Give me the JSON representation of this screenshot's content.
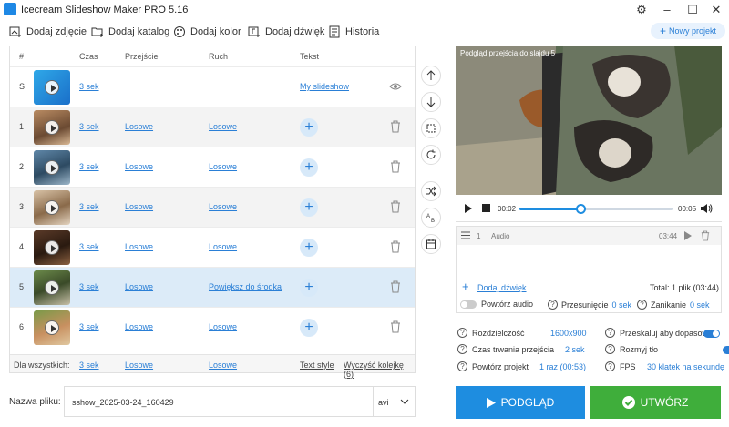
{
  "window": {
    "title": "Icecream Slideshow Maker PRO 5.16"
  },
  "toolbar": {
    "add_photo": "Dodaj zdjęcie",
    "add_folder": "Dodaj katalog",
    "add_color": "Dodaj kolor",
    "add_sound": "Dodaj dźwięk",
    "history": "Historia",
    "new_project": "Nowy projekt"
  },
  "table": {
    "headers": {
      "num": "#",
      "time": "Czas",
      "transition": "Przejście",
      "motion": "Ruch",
      "text": "Tekst"
    },
    "title_row": {
      "num": "S",
      "time": "3 sek",
      "text": "My slideshow"
    },
    "rows": [
      {
        "num": "1",
        "time": "3 sek",
        "transition": "Losowe",
        "motion": "Losowe"
      },
      {
        "num": "2",
        "time": "3 sek",
        "transition": "Losowe",
        "motion": "Losowe"
      },
      {
        "num": "3",
        "time": "3 sek",
        "transition": "Losowe",
        "motion": "Losowe"
      },
      {
        "num": "4",
        "time": "3 sek",
        "transition": "Losowe",
        "motion": "Losowe"
      },
      {
        "num": "5",
        "time": "3 sek",
        "transition": "Losowe",
        "motion": "Powiększ do środka"
      },
      {
        "num": "6",
        "time": "3 sek",
        "transition": "Losowe",
        "motion": "Losowe"
      }
    ],
    "footer": {
      "label": "Dla wszystkich:",
      "time": "3 sek",
      "transition": "Losowe",
      "motion": "Losowe",
      "text_style": "Text style",
      "clear": "Wyczyść kolejkę (6)"
    }
  },
  "preview": {
    "label": "Podgląd przejścia do slajdu 5",
    "current_time": "00:02",
    "total_time": "00:05",
    "progress": 0.4
  },
  "audio": {
    "track_num": "1",
    "track_label": "Audio",
    "track_time": "03:44",
    "add_sound": "Dodaj dźwięk",
    "total": "Total: 1 plik (03:44)",
    "repeat": "Powtórz audio",
    "offset_label": "Przesunięcie",
    "offset_value": "0 sek",
    "fade_label": "Zanikanie",
    "fade_value": "0 sek"
  },
  "settings": {
    "resolution_label": "Rozdzielczość",
    "resolution_value": "1600x900",
    "scale_label": "Przeskaluj aby dopasow.",
    "duration_label": "Czas trwania przejścia",
    "duration_value": "2 sek",
    "blur_label": "Rozmyj tło",
    "repeat_label": "Powtórz projekt",
    "repeat_value": "1 raz (00:53)",
    "fps_label": "FPS",
    "fps_value": "30 klatek na sekundę"
  },
  "file": {
    "label": "Nazwa pliku:",
    "name": "sshow_2025-03-24_160429",
    "format": "avi"
  },
  "actions": {
    "preview": "PODGLĄD",
    "create": "UTWÓRZ"
  },
  "colors": {
    "accent": "#1e8de0",
    "create": "#3fae3b",
    "link": "#2a7fd6",
    "selected_row": "#dcebf8"
  }
}
